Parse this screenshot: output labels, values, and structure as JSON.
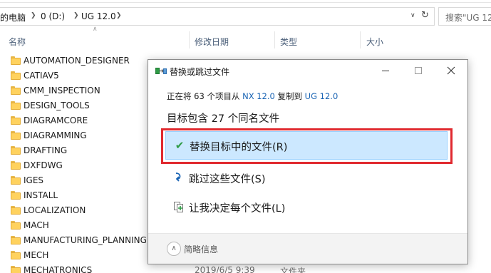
{
  "explorer": {
    "breadcrumb": [
      "的电脑",
      "0 (D:)",
      "UG 12.0"
    ],
    "search_placeholder": "搜索\"UG 12.0",
    "columns": [
      "名称",
      "修改日期",
      "类型",
      "大小"
    ],
    "files": [
      {
        "name": "AUTOMATION_DESIGNER",
        "date": "",
        "type": ""
      },
      {
        "name": "CATIAV5",
        "date": "",
        "type": ""
      },
      {
        "name": "CMM_INSPECTION",
        "date": "",
        "type": ""
      },
      {
        "name": "DESIGN_TOOLS",
        "date": "",
        "type": ""
      },
      {
        "name": "DIAGRAMCORE",
        "date": "",
        "type": ""
      },
      {
        "name": "DIAGRAMMING",
        "date": "",
        "type": ""
      },
      {
        "name": "DRAFTING",
        "date": "",
        "type": ""
      },
      {
        "name": "DXFDWG",
        "date": "",
        "type": ""
      },
      {
        "name": "IGES",
        "date": "",
        "type": ""
      },
      {
        "name": "INSTALL",
        "date": "",
        "type": ""
      },
      {
        "name": "LOCALIZATION",
        "date": "",
        "type": ""
      },
      {
        "name": "MACH",
        "date": "",
        "type": ""
      },
      {
        "name": "MANUFACTURING_PLANNING",
        "date": "",
        "type": ""
      },
      {
        "name": "MECH",
        "date": "",
        "type": ""
      },
      {
        "name": "MECHATRONICS",
        "date": "2019/6/5 9:39",
        "type": "文件夹"
      }
    ]
  },
  "dialog": {
    "title": "替换或跳过文件",
    "status_prefix": "正在将 63 个项目从 ",
    "status_source": "NX 12.0",
    "status_middle": " 复制到 ",
    "status_dest": "UG 12.0",
    "heading": "目标包含 27 个同名文件",
    "options": [
      {
        "label": "替换目标中的文件(R)",
        "icon": "check-icon"
      },
      {
        "label": "跳过这些文件(S)",
        "icon": "skip-arrow-icon"
      },
      {
        "label": "让我决定每个文件(L)",
        "icon": "decide-files-icon"
      }
    ],
    "more_details": "简略信息"
  },
  "colors": {
    "highlight_border": "#e0292f",
    "selected_option_bg": "#cce8ff",
    "link_blue": "#1a64b4",
    "folder_yellow": "#ffd25e"
  }
}
